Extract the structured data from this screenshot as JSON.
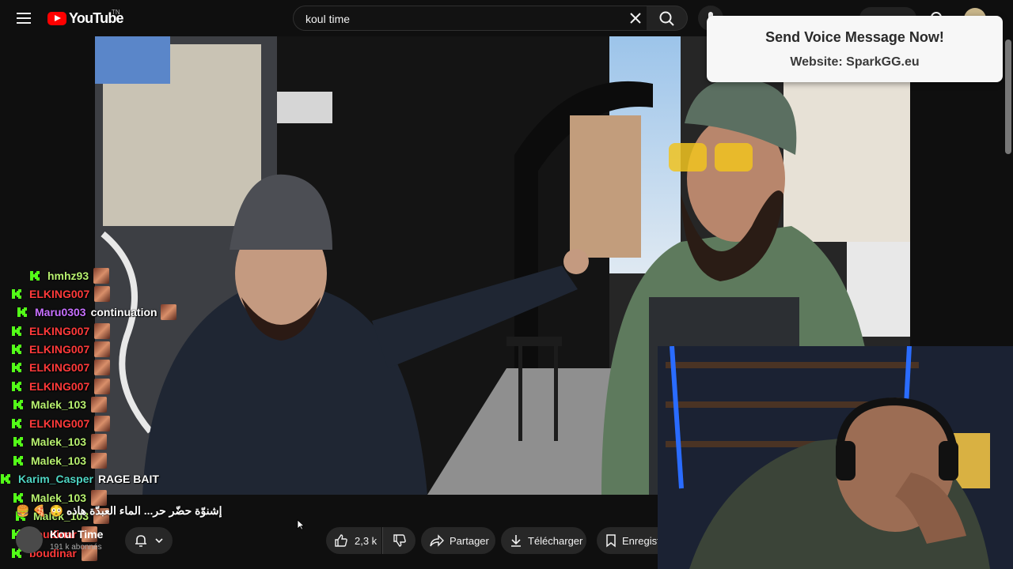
{
  "header": {
    "logo_text": "YouTube",
    "logo_country": "TN",
    "search_value": "koul time"
  },
  "banner": {
    "title": "Send Voice Message Now!",
    "subtitle": "Website: SparkGG.eu"
  },
  "chat": {
    "messages": [
      {
        "user": "hmhz93",
        "color": "#b7f06f",
        "text": "",
        "emote": true
      },
      {
        "user": "ELKING007",
        "color": "#ff3a3a",
        "text": "",
        "emote": true
      },
      {
        "user": "Maru0303",
        "color": "#c770ff",
        "text": "continuation",
        "emote": true
      },
      {
        "user": "ELKING007",
        "color": "#ff3a3a",
        "text": "",
        "emote": true
      },
      {
        "user": "ELKING007",
        "color": "#ff3a3a",
        "text": "",
        "emote": true
      },
      {
        "user": "ELKING007",
        "color": "#ff3a3a",
        "text": "",
        "emote": true
      },
      {
        "user": "ELKING007",
        "color": "#ff3a3a",
        "text": "",
        "emote": true
      },
      {
        "user": "Malek_103",
        "color": "#b7f06f",
        "text": "",
        "emote": true
      },
      {
        "user": "ELKING007",
        "color": "#ff3a3a",
        "text": "",
        "emote": true
      },
      {
        "user": "Malek_103",
        "color": "#b7f06f",
        "text": "",
        "emote": true
      },
      {
        "user": "Malek_103",
        "color": "#b7f06f",
        "text": "",
        "emote": true
      },
      {
        "user": "Karim_Casper",
        "color": "#4fd6c4",
        "text": "RAGE BAIT",
        "emote": false
      },
      {
        "user": "Malek_103",
        "color": "#b7f06f",
        "text": "",
        "emote": true
      },
      {
        "user": "Malek_103",
        "color": "#b7f06f",
        "text": "",
        "emote": true
      },
      {
        "user": "boudinar",
        "color": "#ff3a3a",
        "text": "",
        "emote": true
      },
      {
        "user": "boudinar",
        "color": "#ff3a3a",
        "text": "",
        "emote": true
      }
    ],
    "rtl_message": "إشنوّة حضّر حر... الماء العبدّة هاذه 😳 🍕 🍔"
  },
  "channel": {
    "name": "Koul Time",
    "subscribers": "191 k abonnés"
  },
  "actions": {
    "like_count": "2,3 k",
    "share_label": "Partager",
    "download_label": "Télécharger",
    "save_label": "Enregist"
  },
  "colors": {
    "accent_red": "#ff0000",
    "chat_badge_green": "#53fc18"
  }
}
